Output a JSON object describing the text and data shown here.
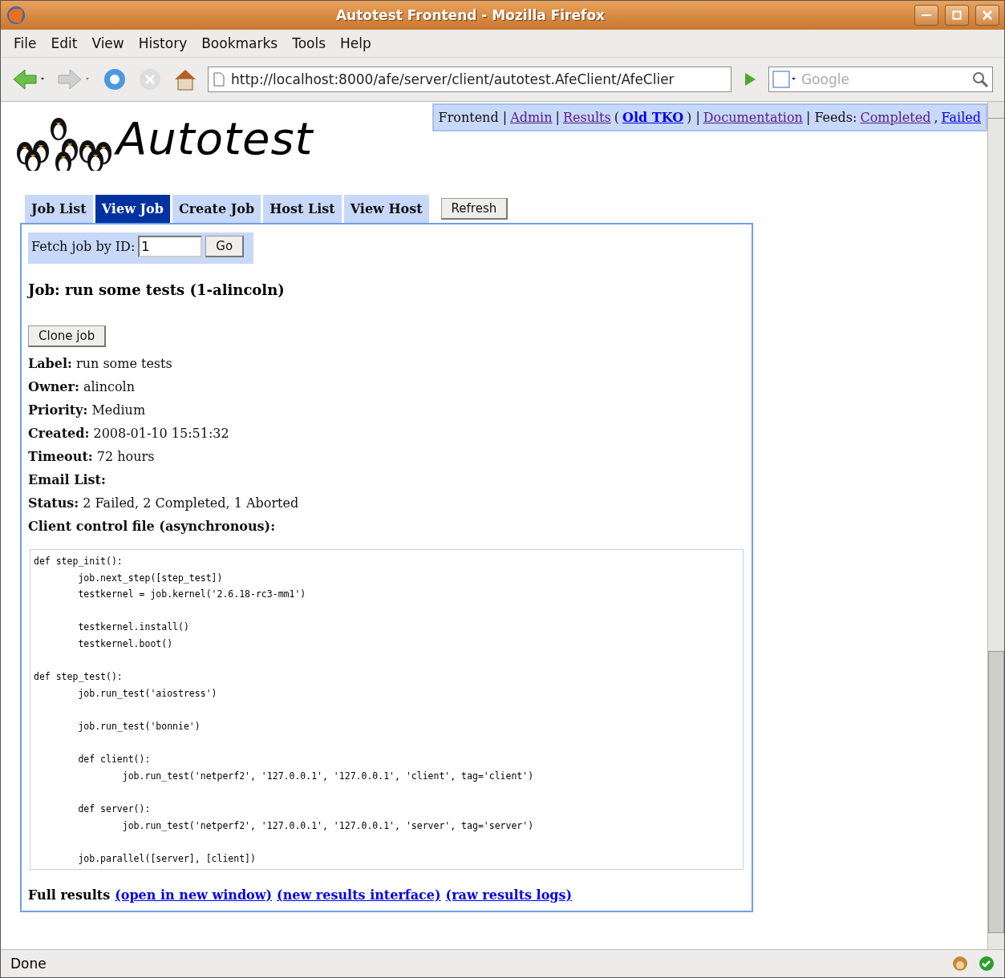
{
  "window": {
    "title": "Autotest Frontend - Mozilla Firefox"
  },
  "menu": [
    "File",
    "Edit",
    "View",
    "History",
    "Bookmarks",
    "Tools",
    "Help"
  ],
  "toolbar": {
    "url": "http://localhost:8000/afe/server/client/autotest.AfeClient/AfeClier",
    "search_placeholder": "Google"
  },
  "logo": {
    "text": "Autotest"
  },
  "header_links": [
    {
      "kind": "text",
      "text": "Frontend |"
    },
    {
      "kind": "link",
      "text": "Admin",
      "visited": true,
      "bold": false
    },
    {
      "kind": "text",
      "text": "|"
    },
    {
      "kind": "link",
      "text": "Results",
      "visited": true,
      "bold": false
    },
    {
      "kind": "text",
      "text": "("
    },
    {
      "kind": "link",
      "text": "Old TKO",
      "visited": false,
      "bold": true
    },
    {
      "kind": "text",
      "text": ") |"
    },
    {
      "kind": "link",
      "text": "Documentation",
      "visited": true,
      "bold": false
    },
    {
      "kind": "text",
      "text": "| Feeds:"
    },
    {
      "kind": "link",
      "text": "Completed",
      "visited": true,
      "bold": false
    },
    {
      "kind": "text",
      "text": ","
    },
    {
      "kind": "link",
      "text": "Failed",
      "visited": false,
      "bold": false
    }
  ],
  "tabs": [
    {
      "label": "Job List",
      "selected": false
    },
    {
      "label": "View Job",
      "selected": true
    },
    {
      "label": "Create Job",
      "selected": false
    },
    {
      "label": "Host List",
      "selected": false
    },
    {
      "label": "View Host",
      "selected": false
    }
  ],
  "refresh_button": "Refresh",
  "fetch": {
    "label": "Fetch job by ID:",
    "value": "1",
    "button": "Go"
  },
  "job": {
    "title": "Job: run some tests (1-alincoln)",
    "clone_button": "Clone job",
    "fields": [
      {
        "label": "Label:",
        "value": "run some tests"
      },
      {
        "label": "Owner:",
        "value": "alincoln"
      },
      {
        "label": "Priority:",
        "value": "Medium"
      },
      {
        "label": "Created:",
        "value": "2008-01-10 15:51:32"
      },
      {
        "label": "Timeout:",
        "value": "72 hours"
      },
      {
        "label": "Email List:"
      },
      {
        "label": "Status:",
        "value": "2 Failed, 2 Completed, 1 Aborted"
      },
      {
        "label": "Client control file (asynchronous):"
      }
    ],
    "code": "def step_init():\n        job.next_step([step_test])\n        testkernel = job.kernel('2.6.18-rc3-mm1')\n\n        testkernel.install()\n        testkernel.boot()\n\ndef step_test():\n        job.run_test('aiostress')\n\n        job.run_test('bonnie')\n\n        def client():\n                job.run_test('netperf2', '127.0.0.1', '127.0.0.1', 'client', tag='client')\n\n        def server():\n                job.run_test('netperf2', '127.0.0.1', '127.0.0.1', 'server', tag='server')\n\n        job.parallel([server], [client])",
    "results_label": "Full results",
    "results_links": [
      "(open in new window)",
      "(new results interface)",
      "(raw results logs)"
    ]
  },
  "status_bar": {
    "text": "Done"
  }
}
